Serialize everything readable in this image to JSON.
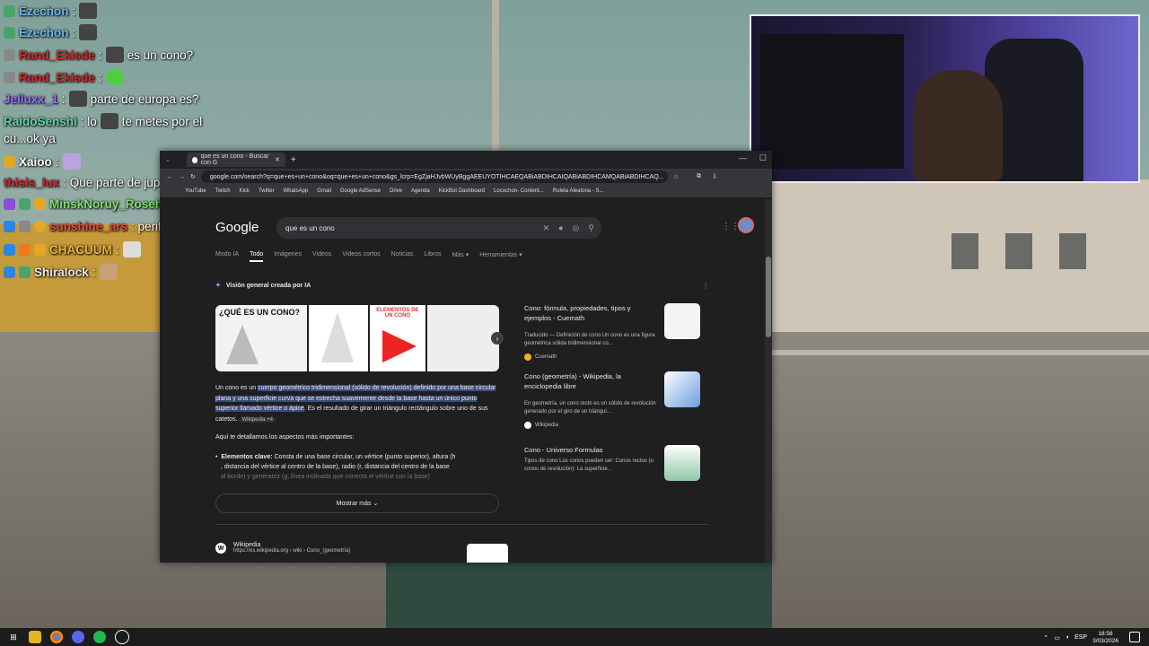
{
  "chat": {
    "messages": [
      {
        "user": "Ezechon",
        "color": "#6fb6e6",
        "text": ""
      },
      {
        "user": "Ezechon",
        "color": "#6fb6e6",
        "text": ""
      },
      {
        "user": "Rand_Ekisde",
        "color": "#d8262a",
        "text": "es un cono?"
      },
      {
        "user": "Rand_Ekisde",
        "color": "#d8262a",
        "text": ""
      },
      {
        "user": "Jelluxx_1",
        "color": "#9b6dff",
        "text": "parte de europa es?"
      },
      {
        "user": "RaidoSenshi",
        "color": "#5fd4a4",
        "text": ": lo",
        "text2": "te metes por el",
        "text3": "cu...ok ya"
      },
      {
        "user": "Xaioo",
        "color": "#ffffff",
        "text": ":"
      },
      {
        "user": "thisis_lux",
        "color": "#d8262a",
        "text": ": Que parte de jupiter es?"
      },
      {
        "user": "MinskNoruy_Rosehearts",
        "color": "#7ee06b",
        "text": ":"
      },
      {
        "user": "sunshine_ars",
        "color": "#e04c4c",
        "text": ": periferia"
      },
      {
        "user": "CHACUUM",
        "color": "#f0b43a",
        "text": ":"
      },
      {
        "user": "Shiralock",
        "color": "#e6e6e6",
        "text": ":"
      }
    ]
  },
  "browser": {
    "tab_title": "que es un cono - Buscar con G",
    "url": "google.com/search?q=que+es+un+cono&oq=que+es+un+cono&gs_lcrp=EgZjaHJvbWUyBggAEEUYOTIHCAEQABiABDIHCAIQABiABDIHCAMQABiABDIHCAQ...",
    "bookmarks": [
      "YouTube",
      "Twitch",
      "Kick",
      "Twitter",
      "WhatsApp",
      "Gmail",
      "Google AdSense",
      "Drive",
      "Agenda",
      "KickBot Dashboard",
      "Locochon- Content...",
      "Ruleta Aleatoria - S..."
    ]
  },
  "google": {
    "logo": "Google",
    "query": "que es un cono",
    "tabs": [
      "Modo IA",
      "Todo",
      "Imágenes",
      "Videos",
      "Videos cortos",
      "Noticias",
      "Libros",
      "Más ▾",
      "Herramientas ▾"
    ],
    "ai_header": "Visión general creada por IA",
    "image_labels": {
      "img1": "¿QUÉ ES UN CONO?",
      "img3": "ELEMENTOS DE UN CONO"
    },
    "ai_text_plain": "Un cono es un ",
    "ai_text_highlight": "cuerpo geométrico tridimensional (sólido de revolución) definido por una base circular plana y una superficie curva que se estrecha suavemente desde la base hasta un único punto superior llamado vértice o ápice",
    "ai_text_tail": ". Es el resultado de girar un triángulo rectángulo sobre uno de sus catetos.",
    "ai_chip": "Wikipedia +4",
    "ai_subhead": "Aquí te detallamos los aspectos más importantes:",
    "ai_bullet_bold": "Elementos clave:",
    "ai_bullet_text": " Consta de una base circular, un vértice (punto superior), altura (h",
    "ai_bullet_line2": ", distancia del vértice al centro de la base), radio (r, distancia del centro de la base",
    "ai_bullet_line3": "al borde) y generatriz (g, línea inclinada que conecta el vértice con la base)",
    "more_button": "Mostrar más ⌄",
    "sources": [
      {
        "title": "Cono: fórmula, propiedades, tipos y ejemplos - Cuemath",
        "snippet": "Traducido — Definición de cono Un cono es una figura geométrica sólida tridimensional co...",
        "site": "Cuemath",
        "fav_color": "#f2b01e"
      },
      {
        "title": "Cono (geometría) - Wikipedia, la enciclopedia libre",
        "snippet": "En geometría, un cono recto es un sólido de revolución generado por el giro de un triángul...",
        "site": "Wikipedia",
        "fav_color": "#ffffff"
      },
      {
        "title": "Cono - Universo Formulas",
        "snippet": "Tipos de cono Los conos pueden ser: Conos rectos (o conos de revolución): La superficie...",
        "site": "",
        "fav_color": "#888888"
      }
    ],
    "result": {
      "site": "Wikipedia",
      "url": "https://es.wikipedia.org › wiki › Cono_(geometría)"
    }
  },
  "taskbar": {
    "lang": "ESP",
    "time": "18:56",
    "date": "3/03/2026"
  }
}
